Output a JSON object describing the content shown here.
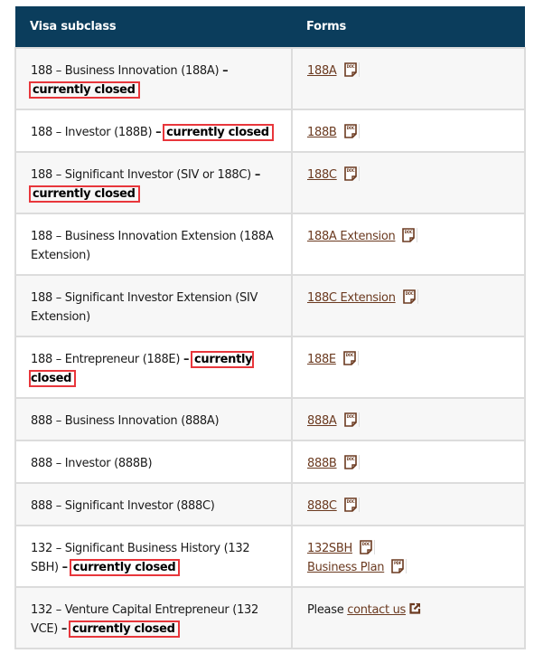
{
  "table": {
    "headers": {
      "subclass": "Visa subclass",
      "forms": "Forms"
    },
    "closed_label": "currently closed",
    "dash": "–",
    "rows": [
      {
        "subclass": "188 – Business Innovation (188A)",
        "closed": true,
        "forms": [
          {
            "label": "188A",
            "icon": "doc-icon",
            "icon_text": "DOC"
          }
        ]
      },
      {
        "subclass": "188 – Investor (188B)",
        "closed": true,
        "forms": [
          {
            "label": "188B",
            "icon": "doc-icon",
            "icon_text": "DOC"
          }
        ]
      },
      {
        "subclass": "188 – Significant Investor (SIV or 188C)",
        "closed": true,
        "forms": [
          {
            "label": "188C",
            "icon": "doc-icon",
            "icon_text": "DOC"
          }
        ]
      },
      {
        "subclass": "188 – Business Innovation Extension (188A Extension)",
        "closed": false,
        "forms": [
          {
            "label": "188A Extension",
            "icon": "doc-icon",
            "icon_text": "DOC"
          }
        ]
      },
      {
        "subclass": "188 – Significant Investor Extension (SIV Extension)",
        "closed": false,
        "forms": [
          {
            "label": "188C Extension",
            "icon": "doc-icon",
            "icon_text": "DOC"
          }
        ]
      },
      {
        "subclass": "188 – Entrepreneur (188E)",
        "closed": true,
        "forms": [
          {
            "label": "188E",
            "icon": "doc-icon",
            "icon_text": "DOC"
          }
        ]
      },
      {
        "subclass": "888 – Business Innovation (888A)",
        "closed": false,
        "forms": [
          {
            "label": "888A",
            "icon": "doc-icon",
            "icon_text": "DOC"
          }
        ]
      },
      {
        "subclass": "888 – Investor (888B)",
        "closed": false,
        "forms": [
          {
            "label": "888B",
            "icon": "doc-icon",
            "icon_text": "DOC"
          }
        ]
      },
      {
        "subclass": "888 – Significant Investor (888C)",
        "closed": false,
        "forms": [
          {
            "label": "888C",
            "icon": "doc-icon",
            "icon_text": "DOC"
          }
        ]
      },
      {
        "subclass": "132 – Significant Business History (132 SBH)",
        "closed": true,
        "forms": [
          {
            "label": "132SBH",
            "icon": "doc-icon",
            "icon_text": "DOC"
          },
          {
            "label": "Business Plan",
            "icon": "pdf-icon",
            "icon_text": "PDF"
          }
        ]
      },
      {
        "subclass": "132 – Venture Capital Entrepreneur (132 VCE)",
        "closed": true,
        "contact": {
          "prefix": "Please",
          "link": "contact us",
          "icon": "external-link-icon"
        }
      }
    ]
  },
  "colors": {
    "header_bg": "#0b3d5c",
    "link": "#6b3a20",
    "highlight_box": "#e8363b",
    "row_alt_bg": "#f7f7f7",
    "border": "#dcdcdc"
  }
}
